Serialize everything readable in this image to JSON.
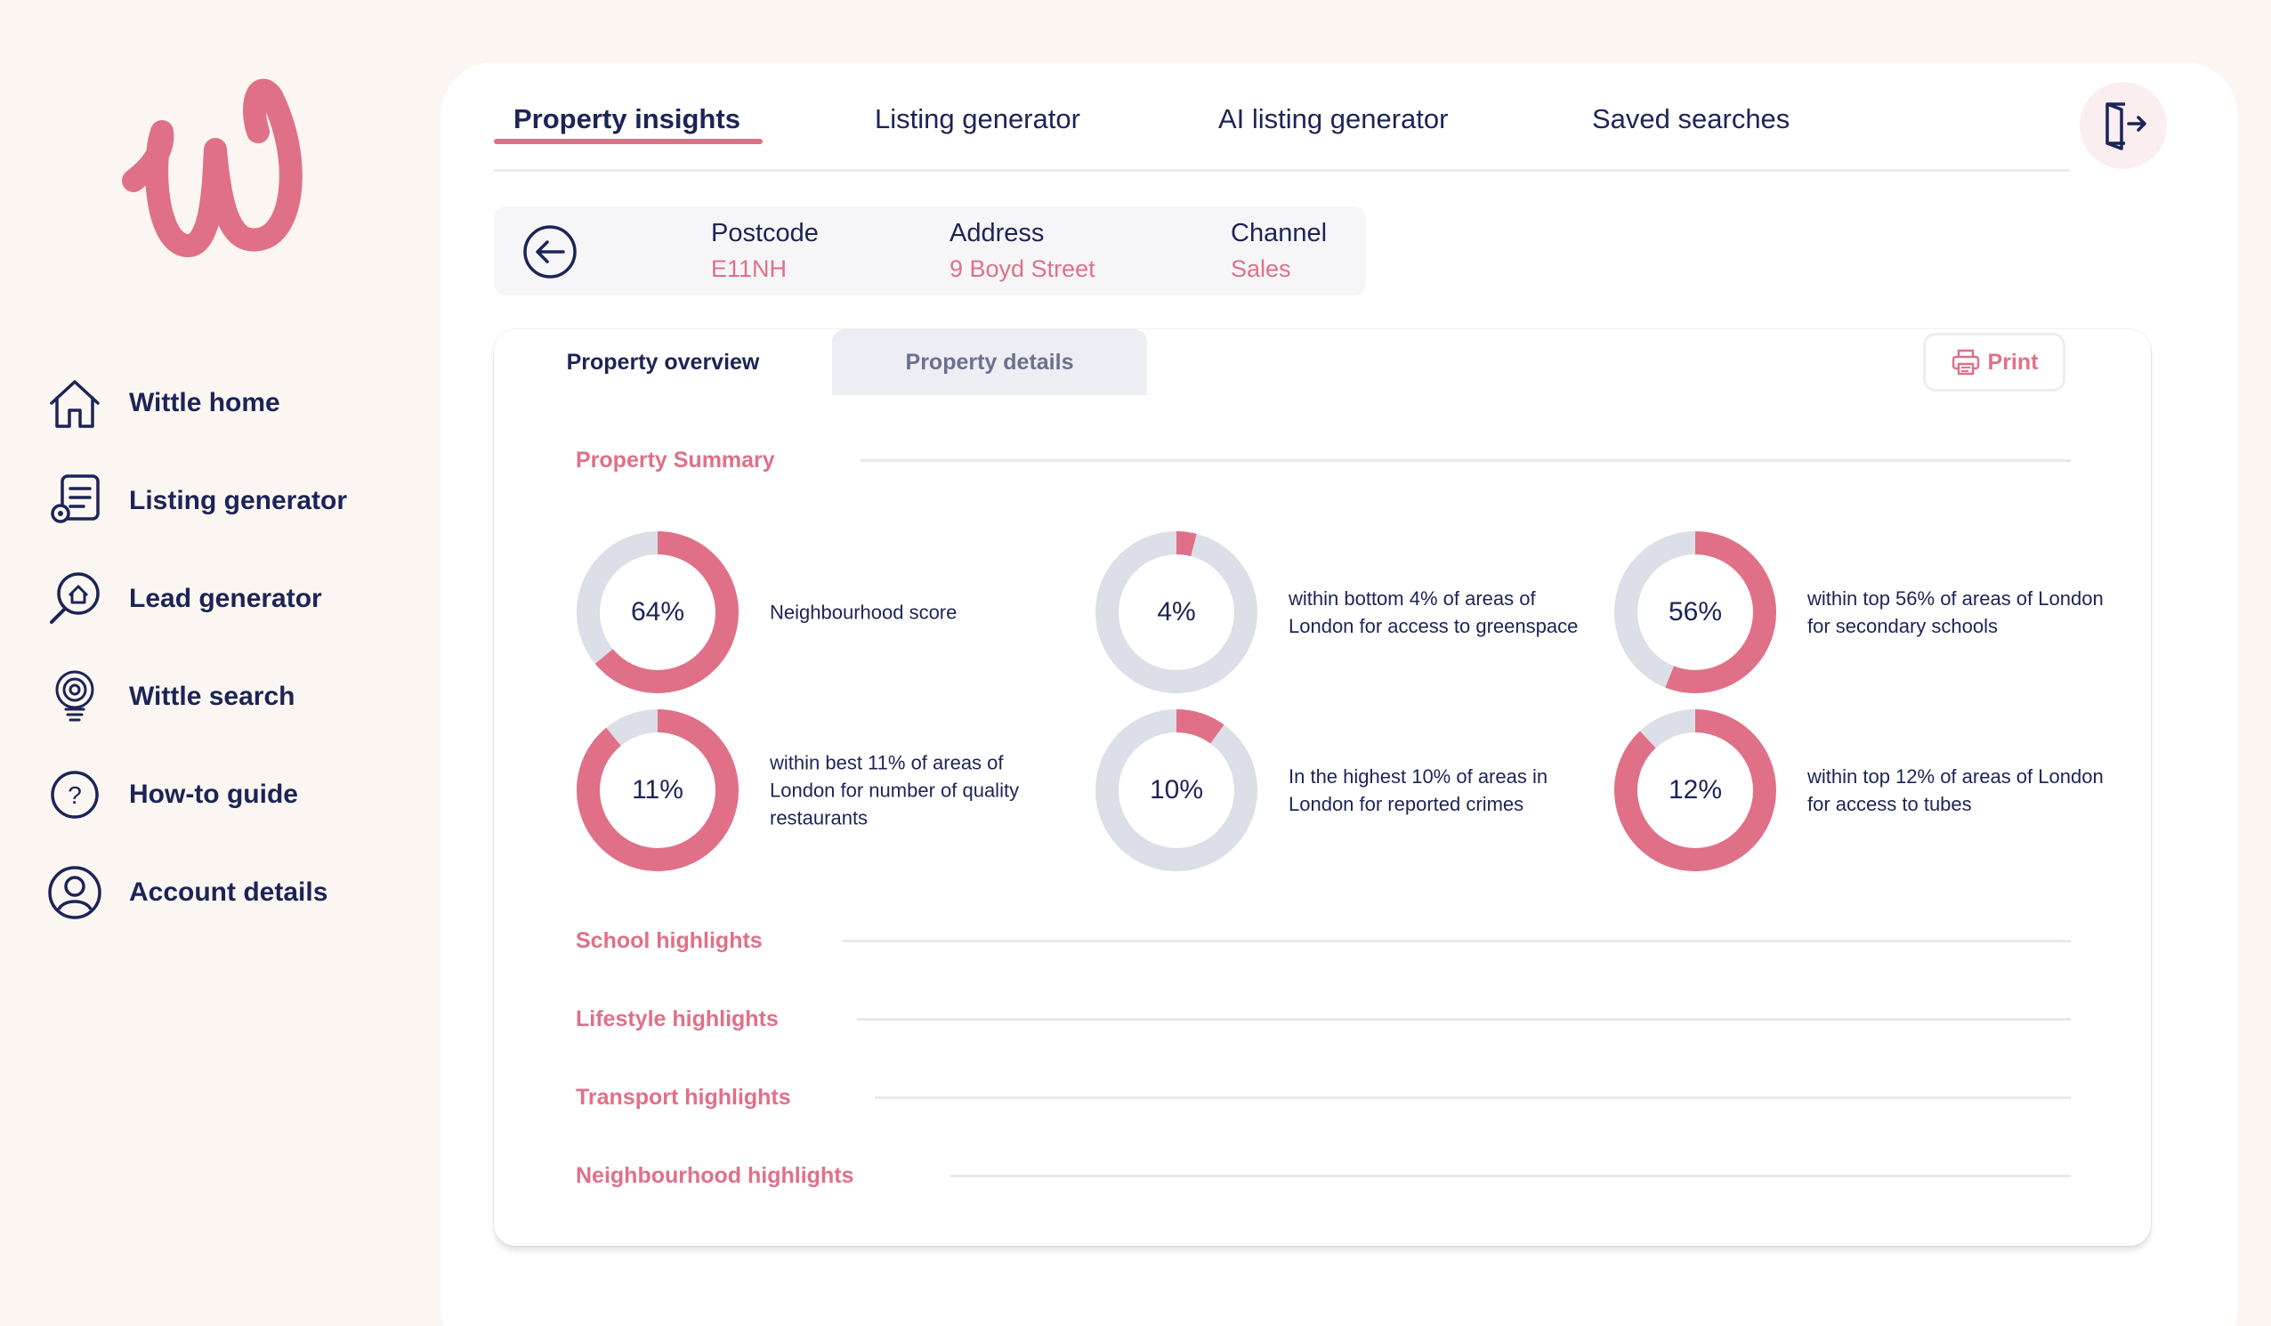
{
  "brand": {
    "accent": "#e07088",
    "navy": "#1c2457",
    "ring_bg": "#dcdee8"
  },
  "sidebar": {
    "items": [
      {
        "label": "Wittle home",
        "icon": "home-icon"
      },
      {
        "label": "Listing generator",
        "icon": "listing-doc-icon"
      },
      {
        "label": "Lead generator",
        "icon": "house-search-icon"
      },
      {
        "label": "Wittle search",
        "icon": "bulb-target-icon"
      },
      {
        "label": "How-to guide",
        "icon": "question-circle-icon"
      },
      {
        "label": "Account details",
        "icon": "user-circle-icon"
      }
    ]
  },
  "topnav": {
    "tabs": [
      {
        "label": "Property insights",
        "active": true
      },
      {
        "label": "Listing generator",
        "active": false
      },
      {
        "label": "AI listing generator",
        "active": false
      },
      {
        "label": "Saved searches",
        "active": false
      }
    ],
    "exit_icon": "logout-icon"
  },
  "property": {
    "postcode_label": "Postcode",
    "postcode": "E11NH",
    "address_label": "Address",
    "address": "9 Boyd Street",
    "channel_label": "Channel",
    "channel": "Sales"
  },
  "card": {
    "tabs": [
      {
        "label": "Property overview",
        "active": true
      },
      {
        "label": "Property details",
        "active": false
      }
    ],
    "print_label": "Print"
  },
  "summary": {
    "title": "Property Summary",
    "metrics": [
      {
        "percent_label": "64%",
        "value": 64,
        "description": "Neighbourhood score"
      },
      {
        "percent_label": "4%",
        "value": 4,
        "description": "within bottom 4% of areas of London for access to greenspace"
      },
      {
        "percent_label": "56%",
        "value": 56,
        "description": "within top 56% of areas of London for secondary schools"
      },
      {
        "percent_label": "11%",
        "value": 89,
        "description": "within best 11% of areas of London for number of quality restaurants"
      },
      {
        "percent_label": "10%",
        "value": 10,
        "description": "In the highest 10% of areas in London for reported crimes"
      },
      {
        "percent_label": "12%",
        "value": 88,
        "description": "within top 12% of areas of London for access to tubes"
      }
    ]
  },
  "sections": [
    {
      "title": "School highlights"
    },
    {
      "title": "Lifestyle highlights"
    },
    {
      "title": "Transport highlights"
    },
    {
      "title": "Neighbourhood highlights"
    }
  ]
}
